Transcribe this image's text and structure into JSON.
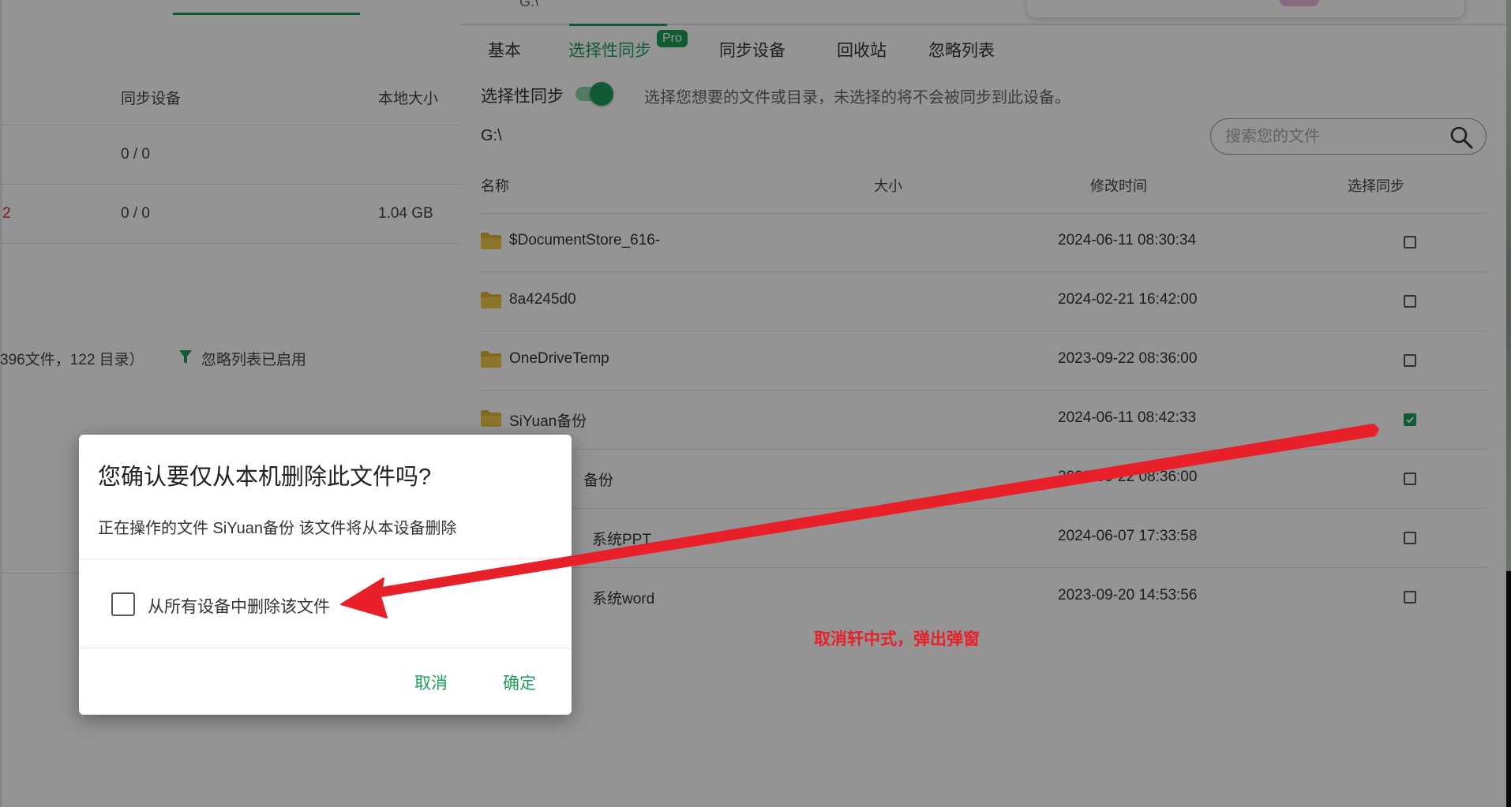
{
  "left_panel": {
    "col_sync_devices": "同步设备",
    "col_local_size": "本地大小",
    "rows": [
      {
        "prefix": "",
        "devices": "0 / 0",
        "size": ""
      },
      {
        "prefix": "2",
        "devices": "0 / 0",
        "size": "1.04 GB"
      }
    ],
    "summary": "396文件，122 目录）",
    "ignore_enabled": "忽略列表已启用"
  },
  "right_panel": {
    "path_top": "G:\\",
    "tabs": [
      "基本",
      "选择性同步",
      "同步设备",
      "回收站",
      "忽略列表"
    ],
    "pro_badge": "Pro",
    "selective_sync_label": "选择性同步",
    "selective_sync_enabled": true,
    "selective_sync_desc": "选择您想要的文件或目录，未选择的将不会被同步到此设备。",
    "path": "G:\\",
    "search_placeholder": "搜索您的文件",
    "columns": {
      "name": "名称",
      "size": "大小",
      "modified": "修改时间",
      "select": "选择同步"
    },
    "files": [
      {
        "name": "$DocumentStore_616-",
        "time": "2024-06-11 08:30:34",
        "checked": false
      },
      {
        "name": "8a4245d0",
        "time": "2024-02-21 16:42:00",
        "checked": false
      },
      {
        "name": "OneDriveTemp",
        "time": "2023-09-22 08:36:00",
        "checked": false
      },
      {
        "name": "SiYuan备份",
        "time": "2024-06-11 08:42:33",
        "checked": true
      },
      {
        "name": "备份",
        "time": "2023-09-22 08:36:00",
        "checked": false
      },
      {
        "name": "系统PPT",
        "time": "2024-06-07 17:33:58",
        "checked": false
      },
      {
        "name": "系统word",
        "time": "2023-09-20 14:53:56",
        "checked": false
      }
    ],
    "annotation": "取消轩中式，弹出弹窗"
  },
  "dialog": {
    "title": "您确认要仅从本机删除此文件吗?",
    "body": "正在操作的文件 SiYuan备份 该文件将从本设备删除",
    "checkbox_label": "从所有设备中删除该文件",
    "checkbox_checked": false,
    "cancel": "取消",
    "confirm": "确定"
  },
  "colors": {
    "accent": "#1e9e5a",
    "annotation_red": "#e8202a",
    "folder": "#e0b53a"
  }
}
